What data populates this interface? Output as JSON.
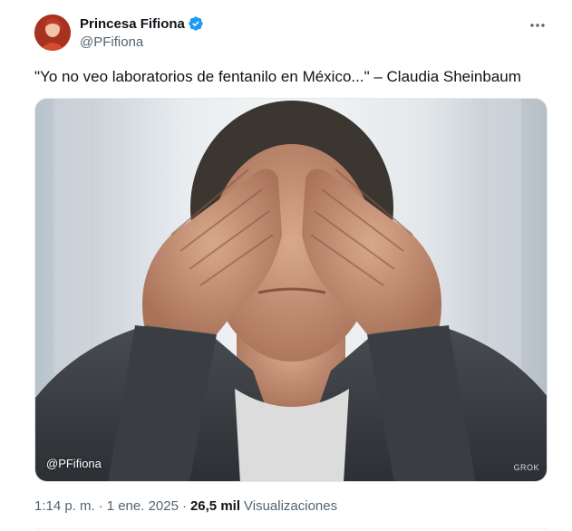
{
  "author": {
    "display_name": "Princesa Fifiona",
    "handle": "@PFifiona",
    "verified": true
  },
  "tweet": {
    "text": "\"Yo no veo laboratorios de fentanilo en México...\" – Claudia Sheinbaum"
  },
  "media": {
    "watermark": "@PFifiona",
    "ai_mark": "GROK"
  },
  "meta": {
    "time": "1:14 p. m.",
    "separator": "·",
    "date": "1 ene. 2025",
    "views_count": "26,5 mil",
    "views_label": "Visualizaciones"
  },
  "colors": {
    "verified_blue": "#1d9bf0",
    "secondary_text": "#536471",
    "primary_text": "#0f1419"
  },
  "icons": {
    "verified": "verified-badge-icon",
    "more": "more-dots-icon"
  }
}
